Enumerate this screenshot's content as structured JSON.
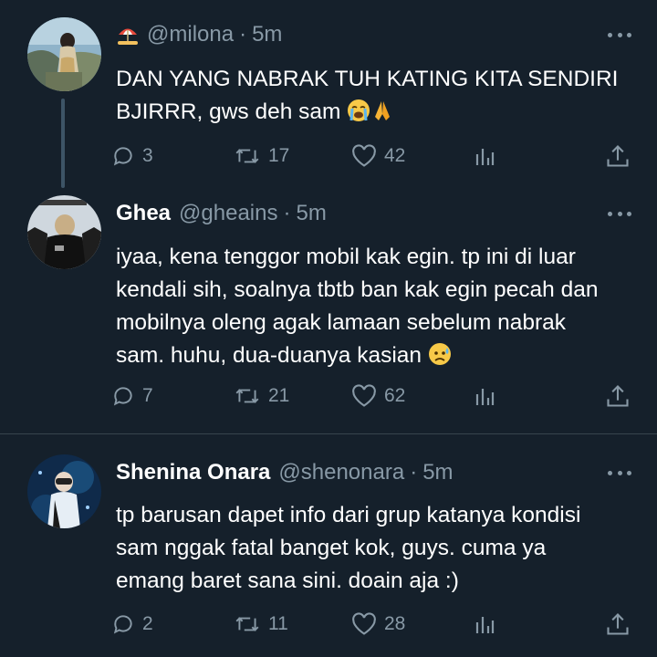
{
  "theme": {
    "background": "#15202b",
    "text_primary": "#ffffff",
    "text_secondary": "#8899a6",
    "divider": "#38444d",
    "thread_line": "#3d5466"
  },
  "tweets": [
    {
      "display_name": "",
      "name_icon": "beach-umbrella-emoji",
      "handle": "@milona",
      "separator": "·",
      "time": "5m",
      "lines": [
        "DAN YANG NABRAK TUH KATING KITA SENDIRI",
        "BJIRRR, gws deh sam"
      ],
      "trailing_emojis": [
        "loudly-crying-face-emoji",
        "folded-hands-emoji"
      ],
      "replies": "3",
      "retweets": "17",
      "likes": "42"
    },
    {
      "display_name": "Ghea",
      "handle": "@gheains",
      "separator": "·",
      "time": "5m",
      "lines": [
        "iyaa, kena tenggor mobil kak egin. tp ini di luar",
        "kendali sih, soalnya tbtb ban kak egin pecah dan",
        "mobilnya oleng agak lamaan sebelum nabrak",
        "sam. huhu, dua-duanya kasian"
      ],
      "trailing_emojis": [
        "sad-but-relieved-face-emoji"
      ],
      "replies": "7",
      "retweets": "21",
      "likes": "62"
    },
    {
      "display_name": "Shenina Onara",
      "handle": "@shenonara",
      "separator": "·",
      "time": "5m",
      "lines": [
        "tp barusan dapet info dari grup katanya kondisi",
        "sam nggak fatal banget kok, guys. cuma ya",
        "emang baret sana sini. doain aja :)"
      ],
      "trailing_emojis": [],
      "replies": "2",
      "retweets": "11",
      "likes": "28"
    }
  ],
  "icons": {
    "reply": "reply-icon",
    "retweet": "retweet-icon",
    "like": "heart-icon",
    "analytics": "analytics-icon",
    "share": "share-icon",
    "more": "more-icon"
  }
}
